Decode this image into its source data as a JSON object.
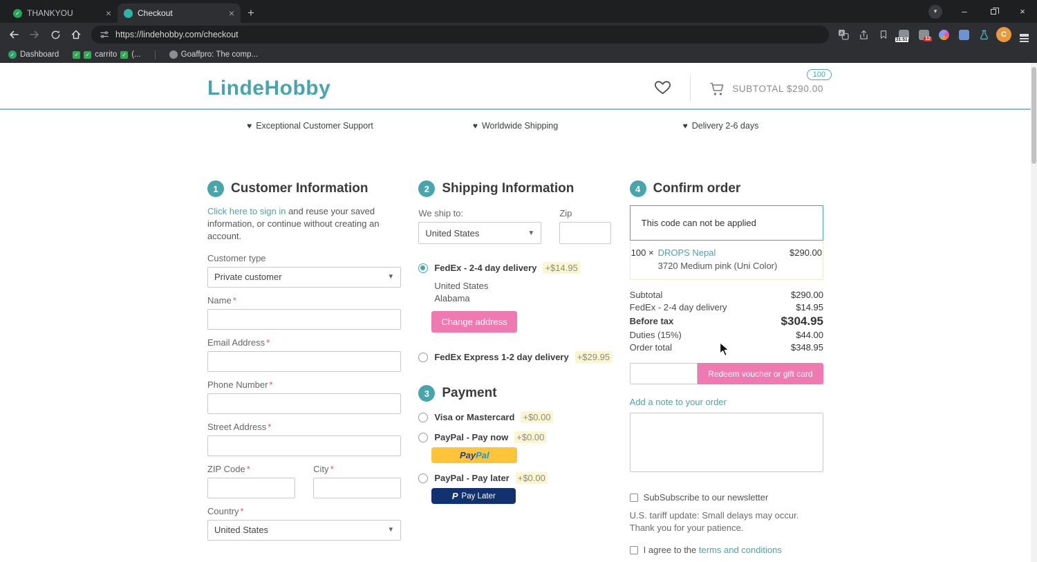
{
  "browser": {
    "tabs": [
      {
        "title": "THANKYOU"
      },
      {
        "title": "Checkout"
      }
    ],
    "url": "https://lindehobby.com/checkout",
    "bookmarks": {
      "dashboard": "Dashboard",
      "carrito": "carrito",
      "carrito_suffix": "(...",
      "goaffpro": "Goaffpro: The comp..."
    },
    "extension_badges": {
      "timer": "31:51",
      "counter": "12"
    },
    "profile_initial": "C"
  },
  "header": {
    "logo": "LindeHobby",
    "subtotal_label": "SUBTOTAL",
    "subtotal_value": "$290.00",
    "cart_badge": "100"
  },
  "benefits": [
    {
      "label": "Exceptional Customer Support"
    },
    {
      "label": "Worldwide Shipping"
    },
    {
      "label": "Delivery 2-6 days"
    }
  ],
  "required_mark": "*",
  "customer": {
    "step": "1",
    "title": "Customer Information",
    "signin_link": "Click here to sign in",
    "signin_text": " and reuse your saved information, or continue without creating an account.",
    "type_label": "Customer type",
    "type_value": "Private customer",
    "fields": [
      {
        "label": "Name"
      },
      {
        "label": "Email Address"
      },
      {
        "label": "Phone Number"
      },
      {
        "label": "Street Address"
      }
    ],
    "zip_label": "ZIP Code",
    "city_label": "City",
    "country_label": "Country",
    "country_value": "United States"
  },
  "shipping": {
    "step": "2",
    "title": "Shipping Information",
    "ship_to_label": "We ship to:",
    "country_value": "United States",
    "zip_label": "Zip",
    "option1": {
      "label": "FedEx - 2-4 day delivery",
      "price": "+$14.95"
    },
    "address_line1": "United States",
    "address_line2": "Alabama",
    "change_button": "Change address",
    "option2": {
      "label": "FedEx Express 1-2 day delivery",
      "price": "+$29.95"
    }
  },
  "payment": {
    "step": "3",
    "title": "Payment",
    "options": [
      {
        "label": "Visa or Mastercard",
        "price": "+$0.00"
      },
      {
        "label": "PayPal - Pay now",
        "price": "+$0.00"
      },
      {
        "label": "PayPal - Pay later",
        "price": "+$0.00"
      }
    ],
    "paypal_pay": "Pay",
    "paypal_pal": "Pal",
    "paylater_p": "P",
    "paylater_label": "Pay Later"
  },
  "confirm": {
    "step": "4",
    "title": "Confirm order",
    "voucher_message": "This code can not be applied",
    "item_qty": "100 ×",
    "item_name": "DROPS Nepal",
    "item_price": "$290.00",
    "item_variant": "3720 Medium pink (Uni Color)",
    "summary": [
      {
        "label": "Subtotal",
        "value": "$290.00"
      },
      {
        "label": "FedEx - 2-4 day delivery",
        "value": "$14.95"
      },
      {
        "label": "Before tax",
        "value": "$304.95"
      },
      {
        "label": "Duties (15%)",
        "value": "$44.00"
      },
      {
        "label": "Order total",
        "value": "$348.95"
      }
    ],
    "redeem_button": "Redeem voucher or gift card",
    "note_link": "Add a note to your order",
    "newsletter_label": "SubSubscribe to our newsletter",
    "tariff_note": "U.S. tariff update: Small delays may occur. Thank you for your patience.",
    "terms_text": "I agree to the ",
    "terms_link": "terms and conditions"
  }
}
